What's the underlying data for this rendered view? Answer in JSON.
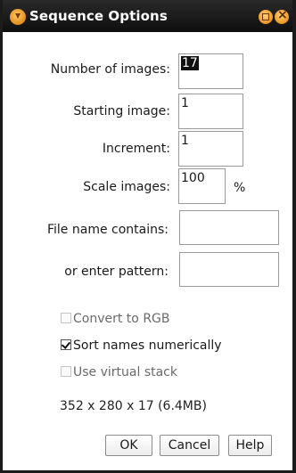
{
  "window": {
    "title": "Sequence Options"
  },
  "fields": {
    "number_of_images": {
      "label": "Number of images:",
      "value": "17"
    },
    "starting_image": {
      "label": "Starting image:",
      "value": "1"
    },
    "increment": {
      "label": "Increment:",
      "value": "1"
    },
    "scale_images": {
      "label": "Scale images:",
      "value": "100",
      "unit": "%"
    },
    "file_name_contains": {
      "label": "File name contains:",
      "value": ""
    },
    "enter_pattern": {
      "label": "or enter pattern:",
      "value": ""
    }
  },
  "options": {
    "convert_rgb": {
      "label": "Convert to RGB",
      "checked": false
    },
    "sort_numerically": {
      "label": "Sort names numerically",
      "checked": true
    },
    "virtual_stack": {
      "label": "Use virtual stack",
      "checked": false
    }
  },
  "info_text": "352 x 280 x 17 (6.4MB)",
  "buttons": {
    "ok": "OK",
    "cancel": "Cancel",
    "help": "Help"
  },
  "colors": {
    "titlebar": "#1a1a1a",
    "title_buttons": "#e38a1a"
  }
}
